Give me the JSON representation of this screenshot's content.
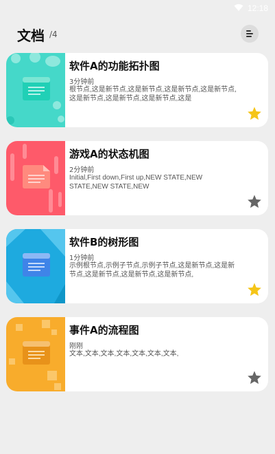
{
  "status_bar": {
    "time": "12:18"
  },
  "header": {
    "title": "文档",
    "count": "/4"
  },
  "colors": {
    "teal": "#45d8c9",
    "red": "#fe5a6a",
    "blue": "#1eaadf",
    "orange": "#f8ac2c",
    "star_fav": "#f5c518",
    "star_off": "#666666"
  },
  "documents": [
    {
      "title": "软件A的功能拓扑图",
      "time": "3分钟前",
      "description": "根节点,这是新节点,这是新节点,这是新节点,这是新节点,这是新节点,这是新节点,这是新节点,这是",
      "favorite": true,
      "thumb_color": "#45d8c9",
      "icon": "document-icon"
    },
    {
      "title": "游戏A的状态机图",
      "time": "2分钟前",
      "description": "Initial,First down,First up,NEW STATE,NEW STATE,NEW STATE,NEW",
      "favorite": false,
      "thumb_color": "#fe5a6a",
      "icon": "document-icon"
    },
    {
      "title": "软件B的树形图",
      "time": "1分钟前",
      "description": "示例根节点,示例子节点,示例子节点,这是新节点,这是新节点,这是新节点,这是新节点,这是新节点,",
      "favorite": true,
      "thumb_color": "#1eaadf",
      "icon": "document-icon"
    },
    {
      "title": "事件A的流程图",
      "time": "刚刚",
      "description": "文本,文本,文本,文本,文本,文本,文本,",
      "favorite": false,
      "thumb_color": "#f8ac2c",
      "icon": "document-icon"
    }
  ]
}
